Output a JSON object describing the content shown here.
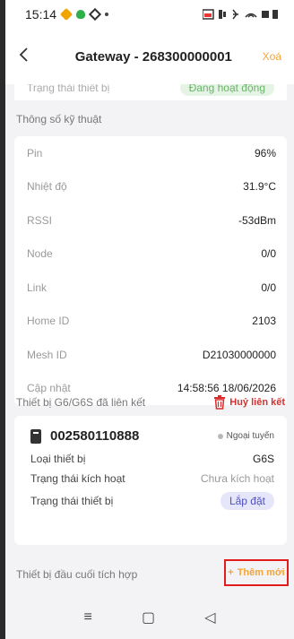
{
  "status": {
    "time": "15:14",
    "right_icons": "▣ ▮ ✱ ⌔ ▣ ▮"
  },
  "appbar": {
    "back_icon": "back-arrow-icon",
    "title": "Gateway - 268300000001",
    "delete_label": "Xoá"
  },
  "partial": {
    "label": "Trạng thái thiết bị",
    "status": "Đang hoạt động"
  },
  "specs": {
    "title": "Thông số kỹ thuật",
    "rows": [
      {
        "label": "Pin",
        "value": "96%"
      },
      {
        "label": "Nhiệt độ",
        "value": "31.9°C"
      },
      {
        "label": "RSSI",
        "value": "-53dBm"
      },
      {
        "label": "Node",
        "value": "0/0"
      },
      {
        "label": "Link",
        "value": "0/0"
      },
      {
        "label": "Home ID",
        "value": "2103"
      },
      {
        "label": "Mesh ID",
        "value": "D21030000000"
      },
      {
        "label": "Cập nhật",
        "value": "14:58:56 18/06/2026"
      }
    ]
  },
  "linked": {
    "title": "Thiết bị G6/G6S đã liên kết",
    "unlink_label": "Huỷ liên kết",
    "device": {
      "id": "002580110888",
      "status": "Ngoại tuyến",
      "rows": [
        {
          "label": "Loại thiết bị",
          "value": "G6S"
        },
        {
          "label": "Trạng thái kích hoạt",
          "value": "Chưa kích hoạt"
        },
        {
          "label": "Trạng thái thiết bị",
          "value": "Lắp đặt"
        }
      ]
    }
  },
  "integrated": {
    "title": "Thiết bị đầu cuối tích hợp",
    "add_label": "Thêm mới",
    "add_symbol": "+"
  },
  "nav": {
    "menu": "≡",
    "home": "▢",
    "back": "◁"
  }
}
